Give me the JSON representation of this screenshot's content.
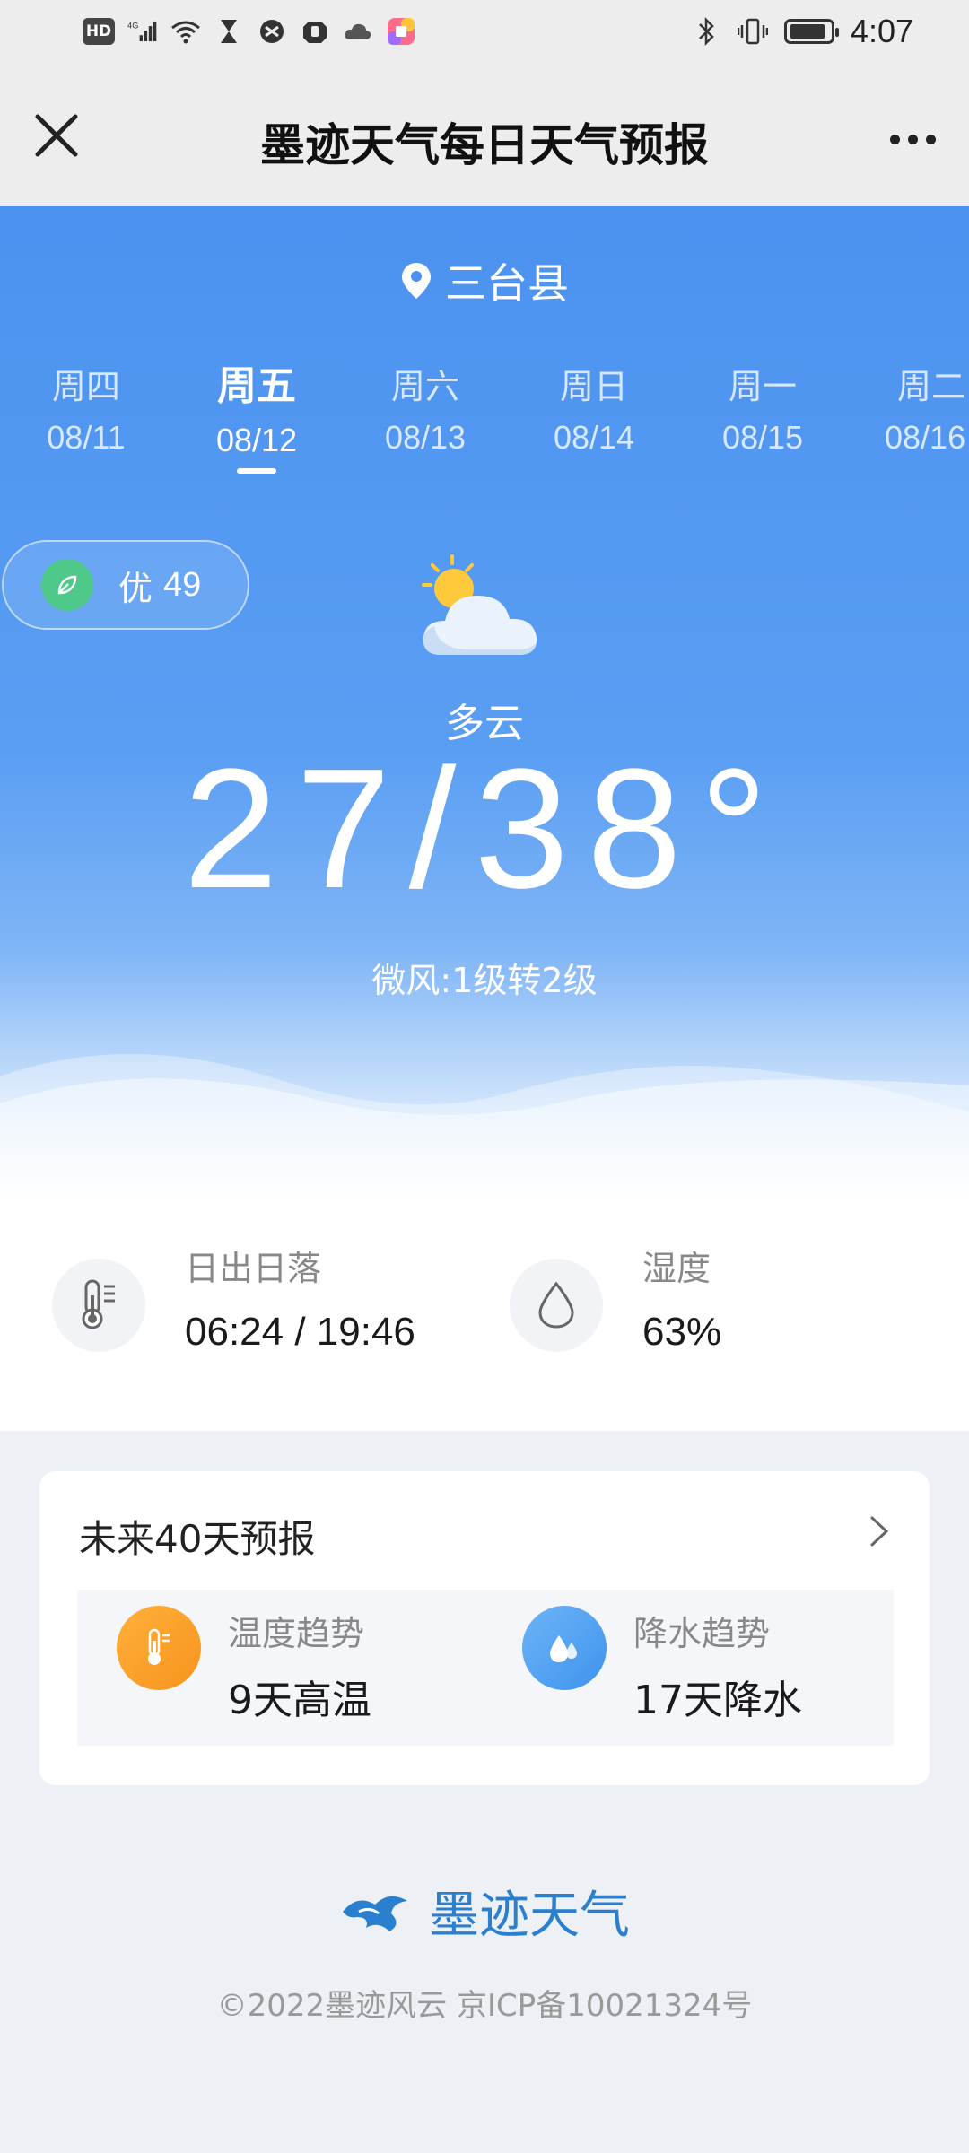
{
  "status_bar": {
    "network": "4G",
    "hd_label": "HD",
    "time": "4:07",
    "battery_level": 0.9
  },
  "header": {
    "title": "墨迹天气每日天气预报"
  },
  "hero": {
    "location": "三台县",
    "days": [
      {
        "weekday": "周四",
        "date": "08/11"
      },
      {
        "weekday": "周五",
        "date": "08/12",
        "active": true
      },
      {
        "weekday": "周六",
        "date": "08/13"
      },
      {
        "weekday": "周日",
        "date": "08/14"
      },
      {
        "weekday": "周一",
        "date": "08/15"
      },
      {
        "weekday": "周二",
        "date": "08/16"
      }
    ],
    "aqi": {
      "label": "优",
      "value": "49"
    },
    "weather_icon": "partly-cloudy-icon",
    "condition": "多云",
    "temperature": "27/38°",
    "wind": "微风:1级转2级"
  },
  "info": {
    "sun": {
      "label": "日出日落",
      "value": "06:24 / 19:46",
      "icon": "thermometer-icon"
    },
    "humidity": {
      "label": "湿度",
      "value": "63%",
      "icon": "water-drop-icon"
    }
  },
  "forecast_card": {
    "title": "未来40天预报",
    "temp_trend": {
      "label": "温度趋势",
      "value": "9天高温",
      "icon": "thermometer-icon",
      "color": "#f7941d"
    },
    "rain_trend": {
      "label": "降水趋势",
      "value": "17天降水",
      "icon": "rain-drops-icon",
      "color": "#3f93ee"
    }
  },
  "footer": {
    "brand": "墨迹天气",
    "copyright": "©2022墨迹风云 京ICP备10021324号"
  },
  "colors": {
    "hero_blue": "#4b92f0",
    "aqi_green": "#4fc98a",
    "brand_blue": "#2a7fcf"
  }
}
